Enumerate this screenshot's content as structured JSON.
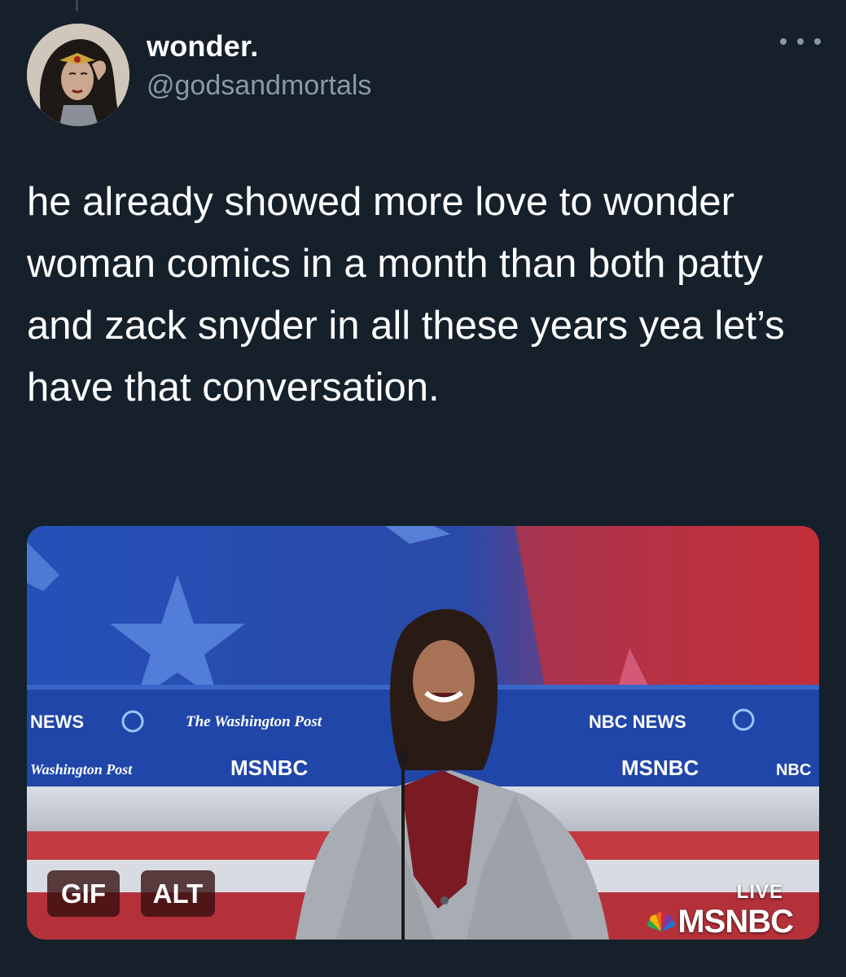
{
  "author": {
    "name": "wonder.",
    "handle": "@godsandmortals"
  },
  "tweet": {
    "text": "he already showed more love to wonder woman comics in a month than both patty and zack snyder in all these years yea let’s have that conversation."
  },
  "media": {
    "badges": {
      "gif": "GIF",
      "alt": "ALT"
    },
    "broadcast": {
      "live_label": "LIVE",
      "network": "MSNBC"
    },
    "backdrop_signs": {
      "news_left": "NEWS",
      "washington_post_top": "The Washington Post",
      "washington_post_bottom": "Washington Post",
      "msnbc_left": "MSNBC",
      "nbc_news": "NBC NEWS",
      "msnbc_right": "MSNBC",
      "nbc_right": "NBC"
    }
  },
  "colors": {
    "background": "#15202b",
    "primary_text": "#ffffff",
    "secondary_text": "#8b98a5",
    "badge_bg": "#320e0e"
  }
}
